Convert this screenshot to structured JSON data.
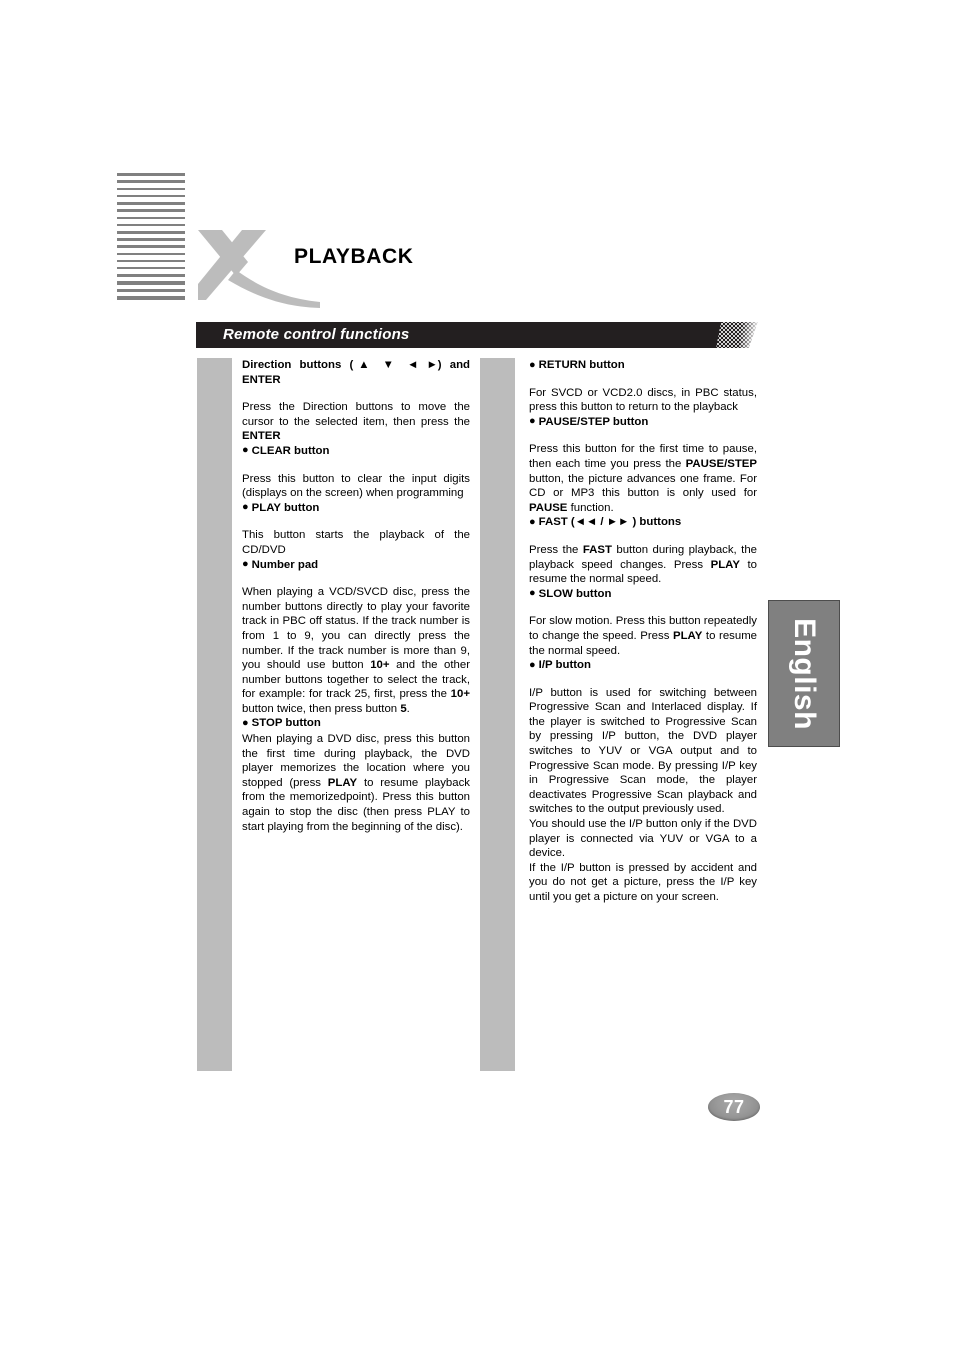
{
  "page": {
    "title": "PLAYBACK",
    "section_bar_label": "Remote control functions",
    "language_tab": "English",
    "page_number": "77"
  },
  "icons": {
    "logo": "x-brand-logo",
    "stripes": "stripe-decoration"
  },
  "left_column": {
    "blocks": [
      {
        "id": "direction-enter",
        "heading_line1": "Direction  buttons  (▲ ▼ ◄ ►)  and",
        "heading_line2": "ENTER",
        "body_prefix": "Press the Direction buttons to move the cursor to the selected item, then press the ",
        "body_bold": "ENTER"
      },
      {
        "id": "clear-button",
        "heading": "CLEAR button",
        "body": "Press this button to clear the input digits (displays on the screen) when programming"
      },
      {
        "id": "play-button",
        "heading": "PLAY button",
        "body": "This button starts the playback of the CD/DVD"
      },
      {
        "id": "number-pad",
        "heading": "Number pad",
        "body_1": "When playing a VCD/SVCD disc, press the number buttons directly to play your favorite track in PBC off status. If the track number is from 1 to 9, you can directly press the number. If the track number is more than 9, you should use button ",
        "body_b1": "10+",
        "body_2": " and the other number buttons together to select the track, for example: for track 25, first, press the ",
        "body_b2": "10+",
        "body_3": " button twice, then press button ",
        "body_b3": "5",
        "body_4": "."
      },
      {
        "id": "stop-button",
        "heading": "STOP button",
        "body_1": "When playing a DVD disc, press this button the first time during playback, the DVD player memorizes the location where you stopped (press ",
        "body_b1": "PLAY",
        "body_2": " to resume playback from the memorizedpoint). Press this button again to stop the disc (then press PLAY to start playing from the beginning of the disc)."
      }
    ]
  },
  "right_column": {
    "blocks": [
      {
        "id": "return-button",
        "heading": "RETURN button",
        "body": "For SVCD or VCD2.0 discs, in PBC status, press this button to return to the playback"
      },
      {
        "id": "pause-step-button",
        "heading": "PAUSE/STEP button",
        "body_1": "Press this button for the first time to pause, then each time you press the ",
        "body_b1": "PAUSE/STEP",
        "body_2": " button, the picture advances one frame. For CD or MP3 this button is only used for ",
        "body_b2": "PAUSE",
        "body_3": " function."
      },
      {
        "id": "fast-buttons",
        "heading": "FAST (◄◄ / ►► ) buttons",
        "body_1": "Press the ",
        "body_b1": "FAST",
        "body_2": " button during playback, the playback speed changes. Press ",
        "body_b2": "PLAY",
        "body_3": " to resume the normal speed."
      },
      {
        "id": "slow-button",
        "heading": "SLOW button",
        "body_1": "For slow motion. Press this button repeatedly to change the speed. Press ",
        "body_b1": "PLAY",
        "body_2": " to resume the normal speed."
      },
      {
        "id": "ip-button",
        "heading": "I/P button",
        "body_1": "I/P button is used for switching between Progressive Scan and Interlaced display. If the player is switched to Progressive Scan by pressing I/P button, the DVD player switches to YUV or VGA output and to Progressive Scan mode. By pressing I/P key in Progressive Scan mode, the player deactivates Progressive Scan playback and switches to the output previously used.",
        "body_2": "You should use the I/P button only if the DVD player is connected via YUV or VGA to a device.",
        "body_3": "If the I/P button is pressed by accident and you do not get a picture, press the I/P key until you get a picture on your screen."
      }
    ]
  },
  "colors": {
    "bar_black": "#231f20",
    "rule_gray": "#bcbcbc",
    "tab_gray": "#808080",
    "logo_gray": "#bcbcbc"
  }
}
